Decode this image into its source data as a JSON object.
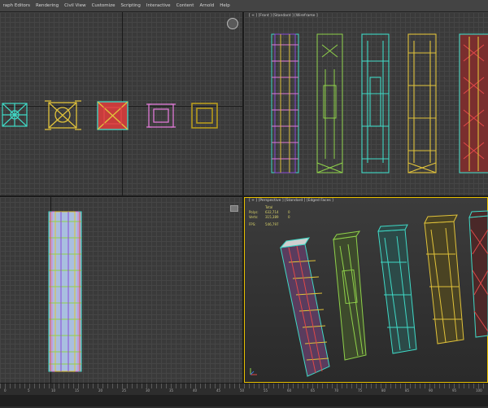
{
  "menu": [
    "raph Editors",
    "Rendering",
    "Civil View",
    "Customize",
    "Scripting",
    "Interactive",
    "Content",
    "Arnold",
    "Help"
  ],
  "viewports": {
    "front_label": "[ + ] [Front ] [Standard ] [Wireframe ]",
    "perspective_label": "[ + ] [Perspective ] [Standard ] [Edged Faces ]"
  },
  "stats": {
    "header": "Total",
    "polys_label": "Polys:",
    "polys_value": "632,714",
    "polys_sel": "0",
    "verts_label": "Verts:",
    "verts_value": "315,389",
    "verts_sel": "0",
    "fps_label": "FPS:",
    "fps_value": "546,797"
  },
  "timeline": {
    "ticks": [
      "0",
      "5",
      "10",
      "15",
      "20",
      "25",
      "30",
      "35",
      "40",
      "45",
      "50",
      "55",
      "60",
      "65",
      "70",
      "75",
      "80",
      "85",
      "90",
      "95",
      "100"
    ]
  },
  "colors": {
    "cyan": "#3fd9c6",
    "yellow": "#e0c23a",
    "red": "#e04848",
    "pink": "#e07ad6",
    "olive": "#b89b1c",
    "green": "#8fd14a",
    "violet": "#8a4ad8",
    "orange": "#e39a3a"
  }
}
